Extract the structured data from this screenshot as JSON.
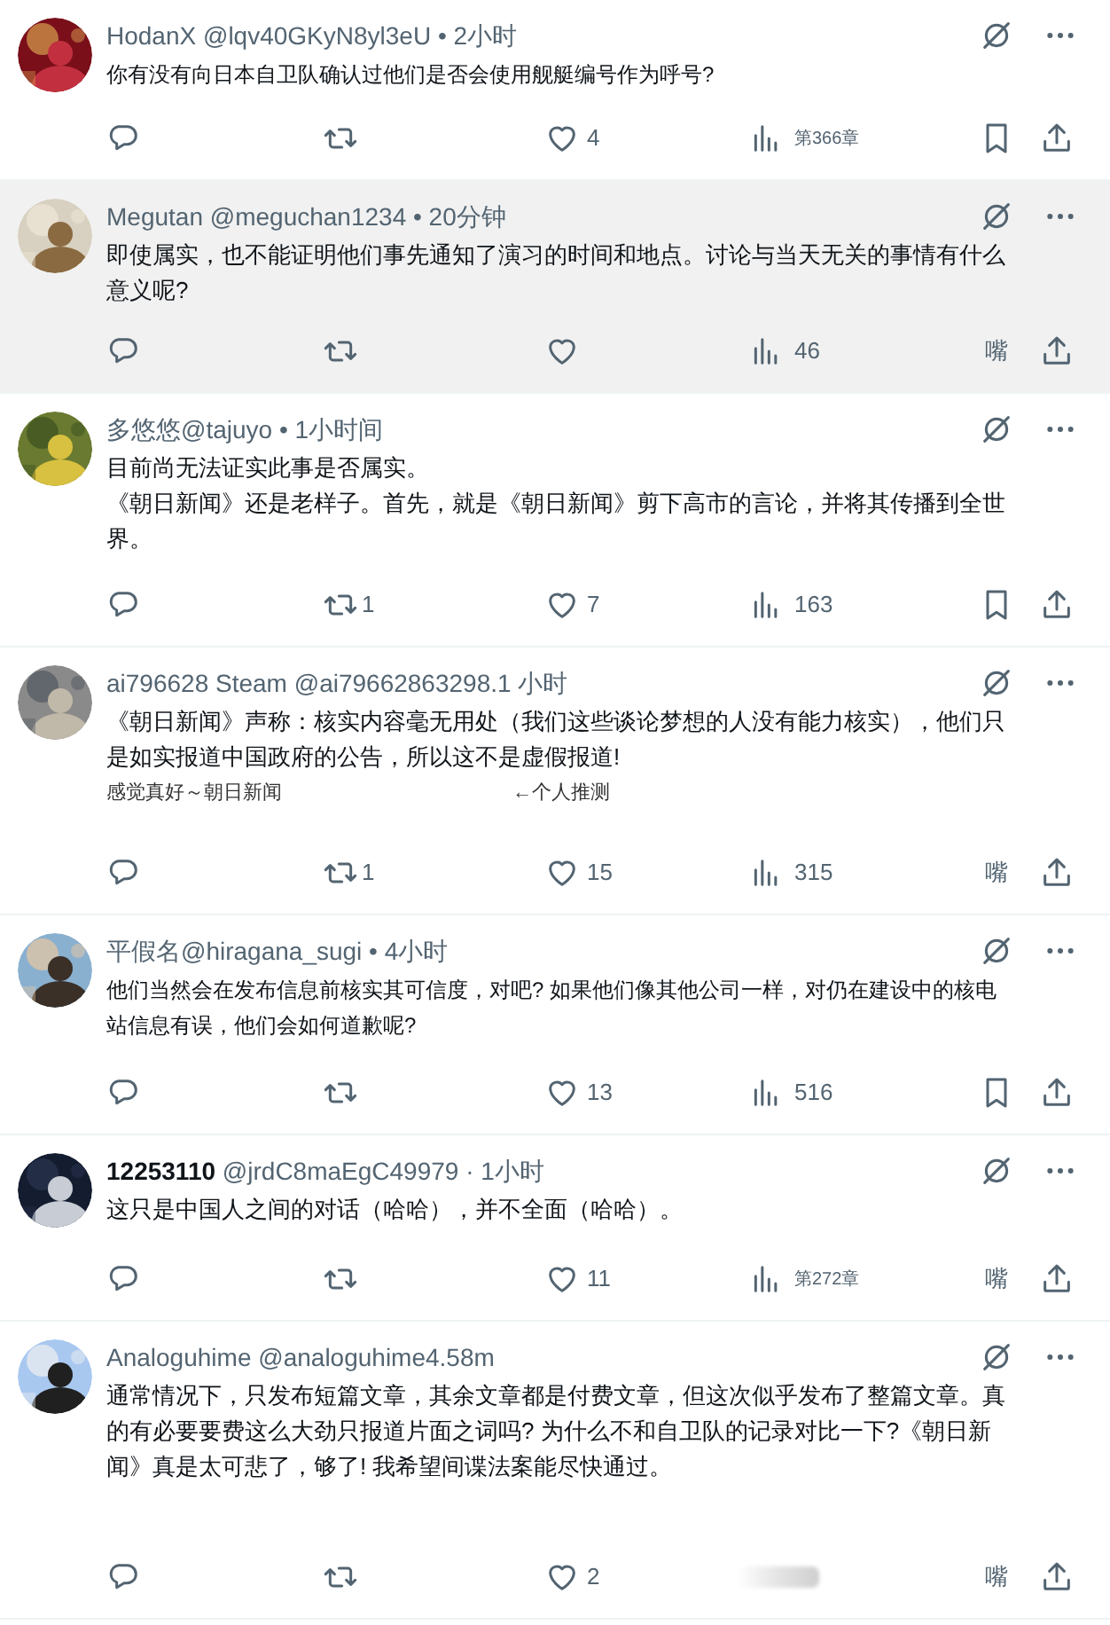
{
  "posts": [
    {
      "name": "HodanX",
      "name_bold": false,
      "meta": " @lqv40GKyN8yl3eU • 2小时",
      "highlighted": false,
      "body": [
        "你有没有向日本自卫队确认过他们是否会使用舰艇编号作为呼号?"
      ],
      "small_body": true,
      "like_count": "4",
      "views": {
        "kind": "small",
        "text": "第366章"
      },
      "end": {
        "kind": "bookmark"
      }
    },
    {
      "name": "Megutan",
      "name_bold": false,
      "meta": " @meguchan1234 • 20分钟",
      "highlighted": true,
      "body": [
        "即使属实，也不能证明他们事先通知了演习的时间和地点。讨论与当天无关的事情有什么意义呢?"
      ],
      "small_body": false,
      "views": {
        "kind": "count",
        "text": "46"
      },
      "end": {
        "kind": "text",
        "text": "嘴"
      }
    },
    {
      "name": "多悠悠",
      "name_bold": false,
      "meta": "@tajuyo • 1小时间",
      "highlighted": false,
      "body": [
        "目前尚无法证实此事是否属实。",
        "《朝日新闻》还是老样子。首先，就是《朝日新闻》剪下高市的言论，并将其传播到全世界。"
      ],
      "small_body": false,
      "repost_count": "1",
      "like_count": "7",
      "views": {
        "kind": "count",
        "text": "163"
      },
      "end": {
        "kind": "bookmark"
      }
    },
    {
      "name": "ai796628 Steam",
      "name_bold": false,
      "meta": " @ai79662863298.1 小时",
      "highlighted": false,
      "body": [
        "《朝日新闻》声称：核实内容毫无用处（我们这些谈论梦想的人没有能力核实），他们只是如实报道中国政府的公告，所以这不是虚假报道!"
      ],
      "small_body": false,
      "notes": [
        "感觉真好～朝日新闻",
        "←个人推测"
      ],
      "repost_count": "1",
      "like_count": "15",
      "views": {
        "kind": "count",
        "text": "315"
      },
      "end": {
        "kind": "text",
        "text": "嘴"
      }
    },
    {
      "name": "平假名",
      "name_bold": false,
      "meta": "@hiragana_sugi • 4小时",
      "highlighted": false,
      "body": [
        "他们当然会在发布信息前核实其可信度，对吧? 如果他们像其他公司一样，对仍在建设中的核电站信息有误，他们会如何道歉呢?"
      ],
      "small_body": true,
      "like_count": "13",
      "views": {
        "kind": "count",
        "text": "516"
      },
      "end": {
        "kind": "bookmark"
      }
    },
    {
      "name": "12253110",
      "name_bold": true,
      "meta": " @jrdC8maEgC49979 · 1小时",
      "highlighted": false,
      "body": [
        "这只是中国人之间的对话（哈哈），并不全面（哈哈）。"
      ],
      "small_body": false,
      "like_count": "11",
      "views": {
        "kind": "small",
        "text": "第272章"
      },
      "end": {
        "kind": "text",
        "text": "嘴"
      }
    },
    {
      "name": "Analoguhime",
      "name_bold": false,
      "meta": " @analoguhime4.58m",
      "highlighted": false,
      "body": [
        "通常情况下，只发布短篇文章，其余文章都是付费文章，但这次似乎发布了整篇文章。真的有必要要费这么大劲只报道片面之词吗? 为什么不和自卫队的记录对比一下?《朝日新闻》真是太可悲了，够了! 我希望间谍法案能尽快通过。"
      ],
      "small_body": false,
      "like_count": "2",
      "views": {
        "kind": "blurred"
      },
      "end": {
        "kind": "text",
        "text": "嘴"
      }
    }
  ]
}
